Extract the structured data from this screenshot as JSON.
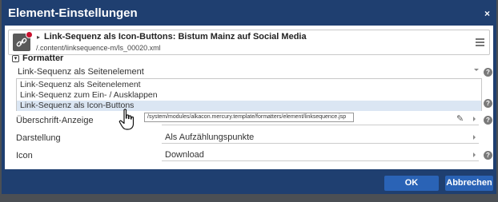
{
  "dialog": {
    "title": "Element-Einstellungen",
    "close_glyph": "×"
  },
  "header": {
    "title": "Link-Sequenz als Icon-Buttons: Bistum Mainz auf Social Media",
    "path": "/.content/linksequence-m/ls_00020.xml",
    "caret": "▸",
    "icon": "link-icon"
  },
  "formatter": {
    "toggle_glyph": "▾",
    "label": "Formatter",
    "selected_value": "Link-Sequenz als Seitenelement",
    "options": [
      "Link-Sequenz als Seitenelement",
      "Link-Sequenz zum Ein- / Ausklappen",
      "Link-Sequenz als Icon-Buttons"
    ],
    "tooltip": "/system/modules/alkacon.mercury.template/formatters/element/linksequence.jsp"
  },
  "settings": {
    "headline_label": "Überschrift-Anzeige",
    "display_label": "Darstellung",
    "display_value": "Als Aufzählungspunkte",
    "icon_label": "Icon",
    "icon_value": "Download"
  },
  "help_glyph": "?",
  "pencil_glyph": "✎",
  "footer": {
    "ok_label": "OK",
    "cancel_label": "Abbrechen"
  },
  "colors": {
    "title_bar": "#1f3f70",
    "button": "#2a63b6",
    "selected_option": "#dbe6f3"
  }
}
